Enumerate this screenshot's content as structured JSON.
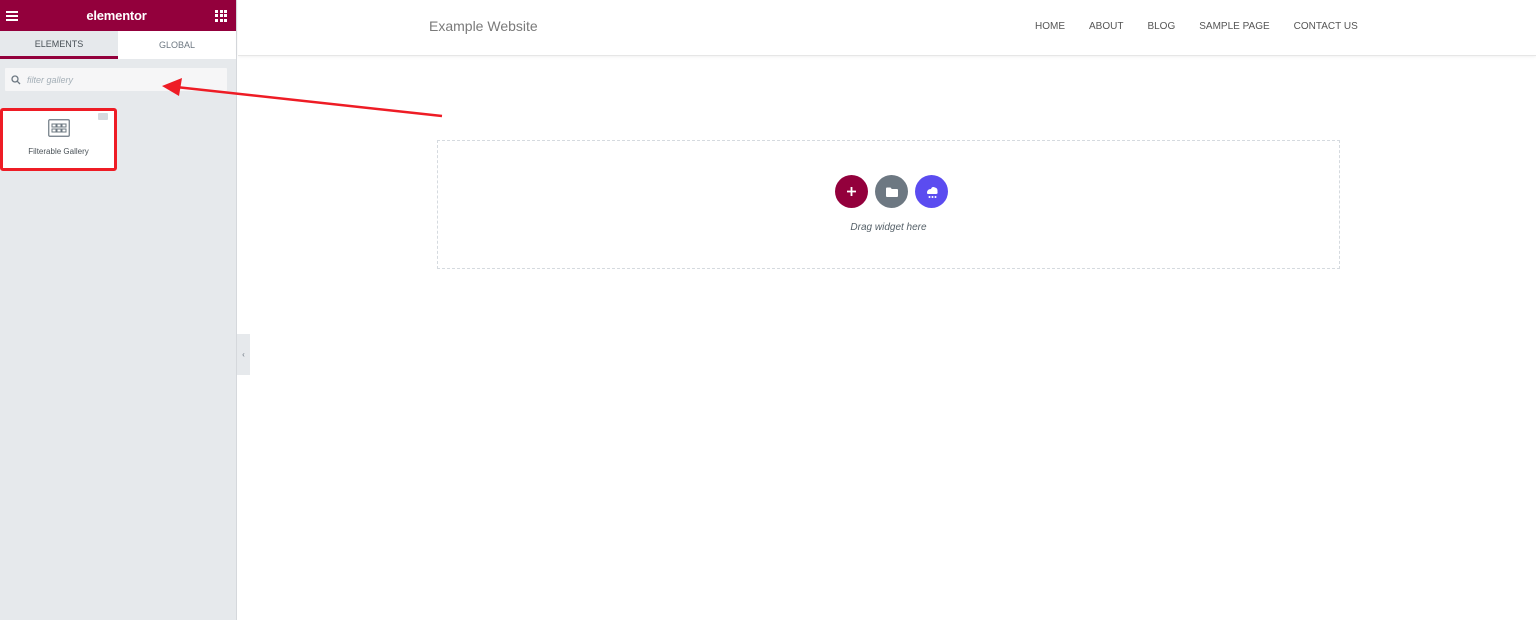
{
  "editor": {
    "brand": "elementor",
    "menu_icon": "hamburger-icon",
    "apps_icon": "grid-icon",
    "tabs": [
      {
        "label": "ELEMENTS",
        "active": true
      },
      {
        "label": "GLOBAL",
        "active": false
      }
    ],
    "search": {
      "placeholder": "filter gallery",
      "value": ""
    },
    "widgets": [
      {
        "label": "Filterable Gallery",
        "icon": "gallery-grid-icon",
        "highlighted": true
      }
    ],
    "accent_color": "#93003c"
  },
  "site": {
    "title": "Example Website",
    "nav": [
      "HOME",
      "ABOUT",
      "BLOG",
      "SAMPLE PAGE",
      "CONTACT US"
    ]
  },
  "dropzone": {
    "text": "Drag widget here",
    "buttons": [
      {
        "icon": "plus-icon",
        "color": "#93003c"
      },
      {
        "icon": "folder-icon",
        "color": "#6d7882"
      },
      {
        "icon": "template-library-icon",
        "color": "#5b4cf0"
      }
    ]
  },
  "annotation": {
    "highlight_color": "#ee1c25"
  }
}
